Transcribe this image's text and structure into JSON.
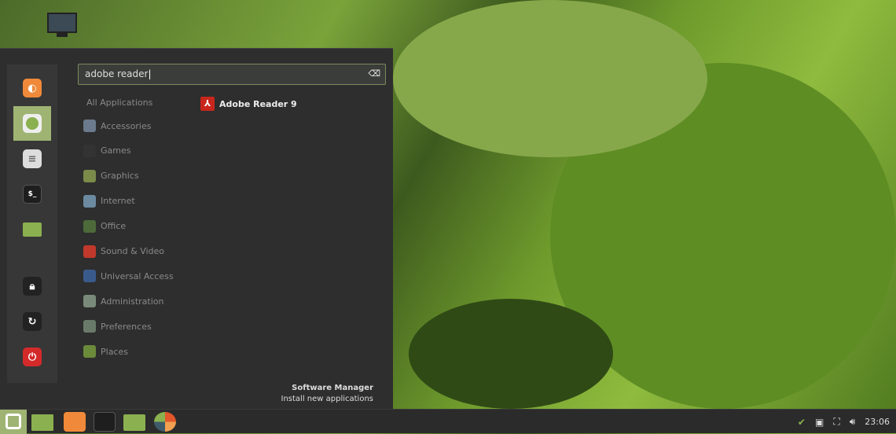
{
  "desktop": {
    "icons": [
      {
        "name": "computer-icon"
      }
    ]
  },
  "menu": {
    "sidebar": [
      {
        "name": "firefox",
        "color": "#f08a3a"
      },
      {
        "name": "software-manager",
        "color": "#8bb04f",
        "active": true
      },
      {
        "name": "settings",
        "color": "#ddd"
      },
      {
        "name": "terminal",
        "color": "#222"
      },
      {
        "name": "files",
        "color": "#8bb04f"
      },
      {
        "name": "lock",
        "color": "#2e2e2e"
      },
      {
        "name": "logout",
        "color": "#2e2e2e"
      },
      {
        "name": "power",
        "color": "#d42a2a"
      }
    ],
    "search": {
      "value": "adobe reader",
      "clear_icon": "backspace-icon"
    },
    "all_applications": "All Applications",
    "categories": [
      {
        "label": "Accessories",
        "color": "#6b7a8c"
      },
      {
        "label": "Games",
        "color": "#333"
      },
      {
        "label": "Graphics",
        "color": "#7a8b4a"
      },
      {
        "label": "Internet",
        "color": "#6c8aa0"
      },
      {
        "label": "Office",
        "color": "#4d6b3a"
      },
      {
        "label": "Sound & Video",
        "color": "#c0392b"
      },
      {
        "label": "Universal Access",
        "color": "#3a5a8c"
      },
      {
        "label": "Administration",
        "color": "#7a8a7a"
      },
      {
        "label": "Preferences",
        "color": "#6a7a6a"
      },
      {
        "label": "Places",
        "color": "#6b8a3a"
      }
    ],
    "results": [
      {
        "label": "Adobe Reader 9",
        "icon": "pdf-icon"
      }
    ],
    "software_manager": {
      "title": "Software Manager",
      "subtitle": "Install new applications"
    }
  },
  "taskbar": {
    "apps": [
      "mint-menu",
      "show-desktop",
      "firefox",
      "terminal",
      "files",
      "app-installer"
    ],
    "clock": "23:06"
  },
  "colors": {
    "accent": "#9fb473",
    "panel": "#2e2e2e"
  }
}
